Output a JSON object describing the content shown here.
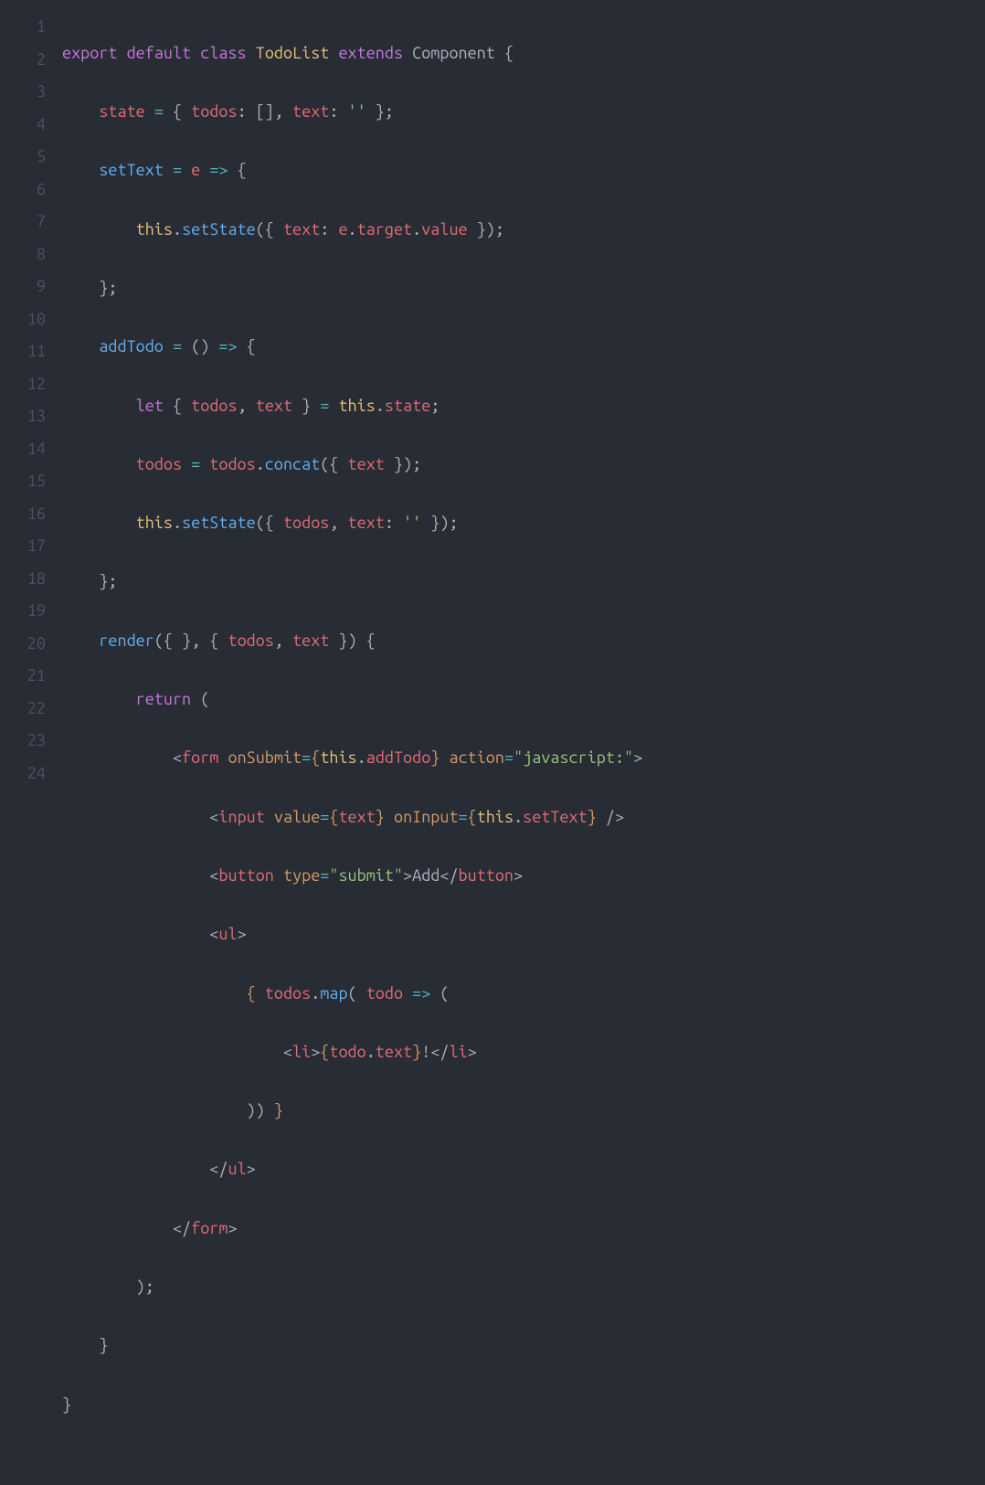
{
  "editor": {
    "language": "jsx",
    "theme": "one-dark",
    "line_numbers": [
      "1",
      "2",
      "3",
      "4",
      "5",
      "6",
      "7",
      "8",
      "9",
      "10",
      "11",
      "12",
      "13",
      "14",
      "15",
      "16",
      "17",
      "18",
      "19",
      "20",
      "21",
      "22",
      "23",
      "24"
    ],
    "code": {
      "class_name": "TodoList",
      "extends": "Component",
      "state_init": "{ todos: [], text: '' }",
      "methods": [
        "setText",
        "addTodo",
        "render"
      ],
      "jsx_tags": [
        "form",
        "input",
        "button",
        "ul",
        "li"
      ],
      "button_text": "Add",
      "form_action": "javascript:",
      "button_type": "submit",
      "raw_lines": [
        "export default class TodoList extends Component {",
        "    state = { todos: [], text: '' };",
        "    setText = e => {",
        "        this.setState({ text: e.target.value });",
        "    };",
        "    addTodo = () => {",
        "        let { todos, text } = this.state;",
        "        todos = todos.concat({ text });",
        "        this.setState({ todos, text: '' });",
        "    };",
        "    render({ }, { todos, text }) {",
        "        return (",
        "            <form onSubmit={this.addTodo} action=\"javascript:\">",
        "                <input value={text} onInput={this.setText} />",
        "                <button type=\"submit\">Add</button>",
        "                <ul>",
        "                    { todos.map( todo => (",
        "                        <li>{todo.text}!</li>",
        "                    )) }",
        "                </ul>",
        "            </form>",
        "        );",
        "    }",
        "}"
      ]
    }
  },
  "tokens": {
    "l1": {
      "export": "export",
      "default": "default",
      "class": "class",
      "TodoList": "TodoList",
      "extends": "extends",
      "Component": "Component",
      "ob": "{"
    },
    "l2": {
      "indent": "    ",
      "state": "state",
      "eq": " = ",
      "ob": "{ ",
      "todos": "todos",
      "c1": ": [], ",
      "text": "text",
      "c2": ": ",
      "str": "''",
      "cb": " };"
    },
    "l3": {
      "indent": "    ",
      "setText": "setText",
      "eq": " = ",
      "e": "e",
      "arrow": " => ",
      "ob": "{"
    },
    "l4": {
      "indent": "        ",
      "this": "this",
      "dot": ".",
      "setState": "setState",
      "op": "({ ",
      "text": "text",
      "col": ": ",
      "e": "e",
      "d1": ".",
      "target": "target",
      "d2": ".",
      "value": "value",
      "cp": " });"
    },
    "l5": {
      "indent": "    ",
      "cb": "};"
    },
    "l6": {
      "indent": "    ",
      "addTodo": "addTodo",
      "eq": " = ",
      "par": "()",
      "arrow": " => ",
      "ob": "{"
    },
    "l7": {
      "indent": "        ",
      "let": "let",
      "sp": " ",
      "ob": "{ ",
      "todos": "todos",
      "c": ", ",
      "text": "text",
      "cb": " } ",
      "eq": "= ",
      "this": "this",
      "dot": ".",
      "state": "state",
      "sc": ";"
    },
    "l8": {
      "indent": "        ",
      "todos": "todos",
      "eq": " = ",
      "todos2": "todos",
      "dot": ".",
      "concat": "concat",
      "op": "({ ",
      "text": "text",
      "cp": " });"
    },
    "l9": {
      "indent": "        ",
      "this": "this",
      "dot": ".",
      "setState": "setState",
      "op": "({ ",
      "todos": "todos",
      "c": ", ",
      "text": "text",
      "col": ": ",
      "str": "''",
      "cp": " });"
    },
    "l10": {
      "indent": "    ",
      "cb": "};"
    },
    "l11": {
      "indent": "    ",
      "render": "render",
      "op": "(",
      "ob1": "{ }",
      ", ": ", ",
      "ob2": "{ ",
      "todos": "todos",
      "c": ", ",
      "text": "text",
      "cb2": " }",
      "cp": ") ",
      "ob": "{"
    },
    "l12": {
      "indent": "        ",
      "return": "return",
      "sp": " ("
    },
    "l13": {
      "indent": "            ",
      "lt": "<",
      "form": "form",
      "sp": " ",
      "onSubmit": "onSubmit",
      "eq": "=",
      "ob": "{",
      "this": "this",
      "dot": ".",
      "addTodo": "addTodo",
      "cb": "}",
      "sp2": " ",
      "action": "action",
      "eq2": "=",
      "str": "\"javascript:\"",
      "gt": ">"
    },
    "l14": {
      "indent": "                ",
      "lt": "<",
      "input": "input",
      "sp": " ",
      "value": "value",
      "eq": "=",
      "ob": "{",
      "text": "text",
      "cb": "}",
      "sp2": " ",
      "onInput": "onInput",
      "eq2": "=",
      "ob2": "{",
      "this": "this",
      "dot": ".",
      "setText": "setText",
      "cb2": "}",
      "sp3": " ",
      "sc": "/>"
    },
    "l15": {
      "indent": "                ",
      "lt": "<",
      "button": "button",
      "sp": " ",
      "type": "type",
      "eq": "=",
      "str": "\"submit\"",
      "gt": ">",
      "Add": "Add",
      "lt2": "</",
      "button2": "button",
      "gt2": ">"
    },
    "l16": {
      "indent": "                ",
      "lt": "<",
      "ul": "ul",
      "gt": ">"
    },
    "l17": {
      "indent": "                    ",
      "ob": "{ ",
      "todos": "todos",
      "dot": ".",
      "map": "map",
      "op": "( ",
      "todo": "todo",
      "arrow": " => ",
      "p": "("
    },
    "l18": {
      "indent": "                        ",
      "lt": "<",
      "li": "li",
      "gt": ">",
      "ob": "{",
      "todo": "todo",
      "dot": ".",
      "text": "text",
      "cb": "}",
      "ex": "!",
      "lt2": "</",
      "li2": "li",
      "gt2": ">"
    },
    "l19": {
      "indent": "                    ",
      "cp": ")) ",
      "cb": "}"
    },
    "l20": {
      "indent": "                ",
      "lt": "</",
      "ul": "ul",
      "gt": ">"
    },
    "l21": {
      "indent": "            ",
      "lt": "</",
      "form": "form",
      "gt": ">"
    },
    "l22": {
      "indent": "        ",
      "cp": ");"
    },
    "l23": {
      "indent": "    ",
      "cb": "}"
    },
    "l24": {
      "cb": "}"
    }
  }
}
